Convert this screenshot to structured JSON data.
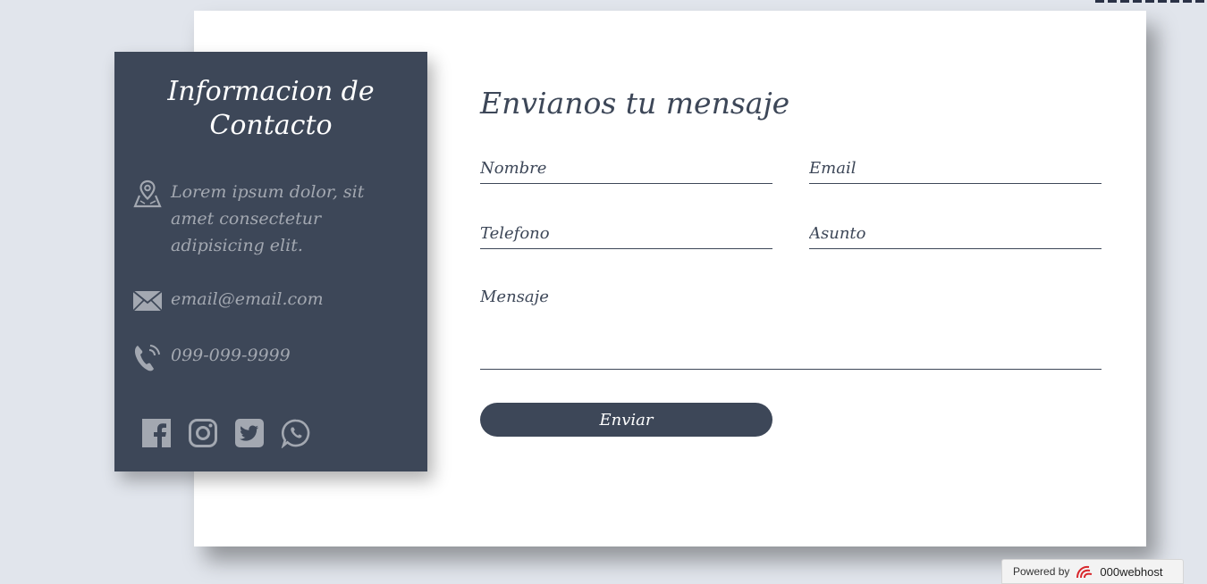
{
  "contact_info": {
    "title": "Informacion de Contacto",
    "address": "Lorem ipsum dolor, sit amet consectetur adipisicing elit.",
    "email": "email@email.com",
    "phone": "099-099-9999",
    "icons": {
      "address": "map-pin-icon",
      "email": "envelope-icon",
      "phone": "phone-icon"
    },
    "social": [
      "facebook-icon",
      "instagram-icon",
      "twitter-icon",
      "whatsapp-icon"
    ]
  },
  "form": {
    "title": "Envianos tu mensaje",
    "name_placeholder": "Nombre",
    "email_placeholder": "Email",
    "phone_placeholder": "Telefono",
    "subject_placeholder": "Asunto",
    "message_placeholder": "Mensaje",
    "submit_label": "Enviar"
  },
  "footer_badge": {
    "prefix": "Powered by",
    "brand": "000webhost"
  },
  "colors": {
    "background": "#e1e5ec",
    "panel": "#3d4758",
    "muted_text": "#a3a8b1",
    "brand_red": "#d8262b"
  }
}
